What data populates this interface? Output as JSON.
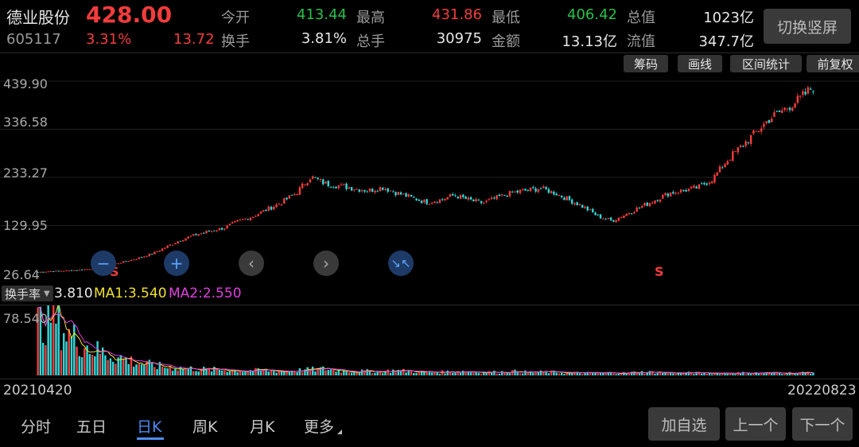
{
  "stock": {
    "name": "德业股份",
    "price": "428.00",
    "code": "605117",
    "change_pct": "3.31%",
    "change_amt": "13.72"
  },
  "quote": {
    "open_label": "今开",
    "open_value": "413.44",
    "high_label": "最高",
    "high_value": "431.86",
    "low_label": "最低",
    "low_value": "406.42",
    "total_cap_label": "总值",
    "total_cap_value": "1023亿",
    "turnover_label": "换手",
    "turnover_value": "3.81%",
    "volume_label": "总手",
    "volume_value": "30975",
    "amount_label": "金额",
    "amount_value": "13.13亿",
    "float_cap_label": "流值",
    "float_cap_value": "347.7亿"
  },
  "switch_button": "切换竖屏",
  "toolbar": [
    "筹码",
    "画线",
    "区间统计",
    "前复权"
  ],
  "price_axis": [
    "439.90",
    "336.58",
    "233.27",
    "129.95",
    "26.64"
  ],
  "signal_markers": [
    "S",
    "S"
  ],
  "controls": [
    "zoom-out-icon",
    "plus-icon",
    "chevron-left-icon",
    "chevron-right-icon",
    "collapse-icon"
  ],
  "indicator": {
    "name": "换手率",
    "value": "3.810",
    "ma1_label": "MA1:3.540",
    "ma2_label": "MA2:2.550",
    "top_value": "78.540",
    "ma1_color": "#f0e130",
    "ma2_color": "#e040e0"
  },
  "dates": {
    "start": "20210420",
    "end": "20220823"
  },
  "tabs": [
    "分时",
    "五日",
    "日K",
    "周K",
    "月K",
    "更多"
  ],
  "active_tab": "日K",
  "bottom_buttons": [
    "加自选",
    "上一个",
    "下一个"
  ],
  "chart_data": {
    "type": "candlestick",
    "x_range": [
      "20210420",
      "20220823"
    ],
    "y_range": [
      26.64,
      439.9
    ],
    "close_trend": [
      30,
      32,
      33,
      35,
      38,
      45,
      52,
      60,
      70,
      85,
      100,
      110,
      118,
      125,
      140,
      150,
      165,
      180,
      200,
      235,
      220,
      215,
      210,
      205,
      212,
      200,
      190,
      180,
      185,
      195,
      185,
      178,
      190,
      200,
      205,
      210,
      200,
      185,
      170,
      150,
      140,
      155,
      170,
      185,
      200,
      205,
      212,
      230,
      270,
      300,
      330,
      360,
      380,
      400,
      428
    ],
    "turnover_trend": [
      60,
      78,
      50,
      40,
      30,
      25,
      20,
      15,
      12,
      10,
      9,
      8,
      7,
      7,
      6,
      6,
      6,
      5,
      6,
      7,
      8,
      6,
      5,
      5,
      5,
      6,
      5,
      4,
      4,
      5,
      5,
      4,
      4,
      5,
      4,
      4,
      4,
      3,
      3,
      3,
      3,
      3,
      4,
      4,
      3,
      3,
      3,
      3,
      3,
      3,
      3,
      3,
      3,
      3,
      3.81
    ]
  }
}
